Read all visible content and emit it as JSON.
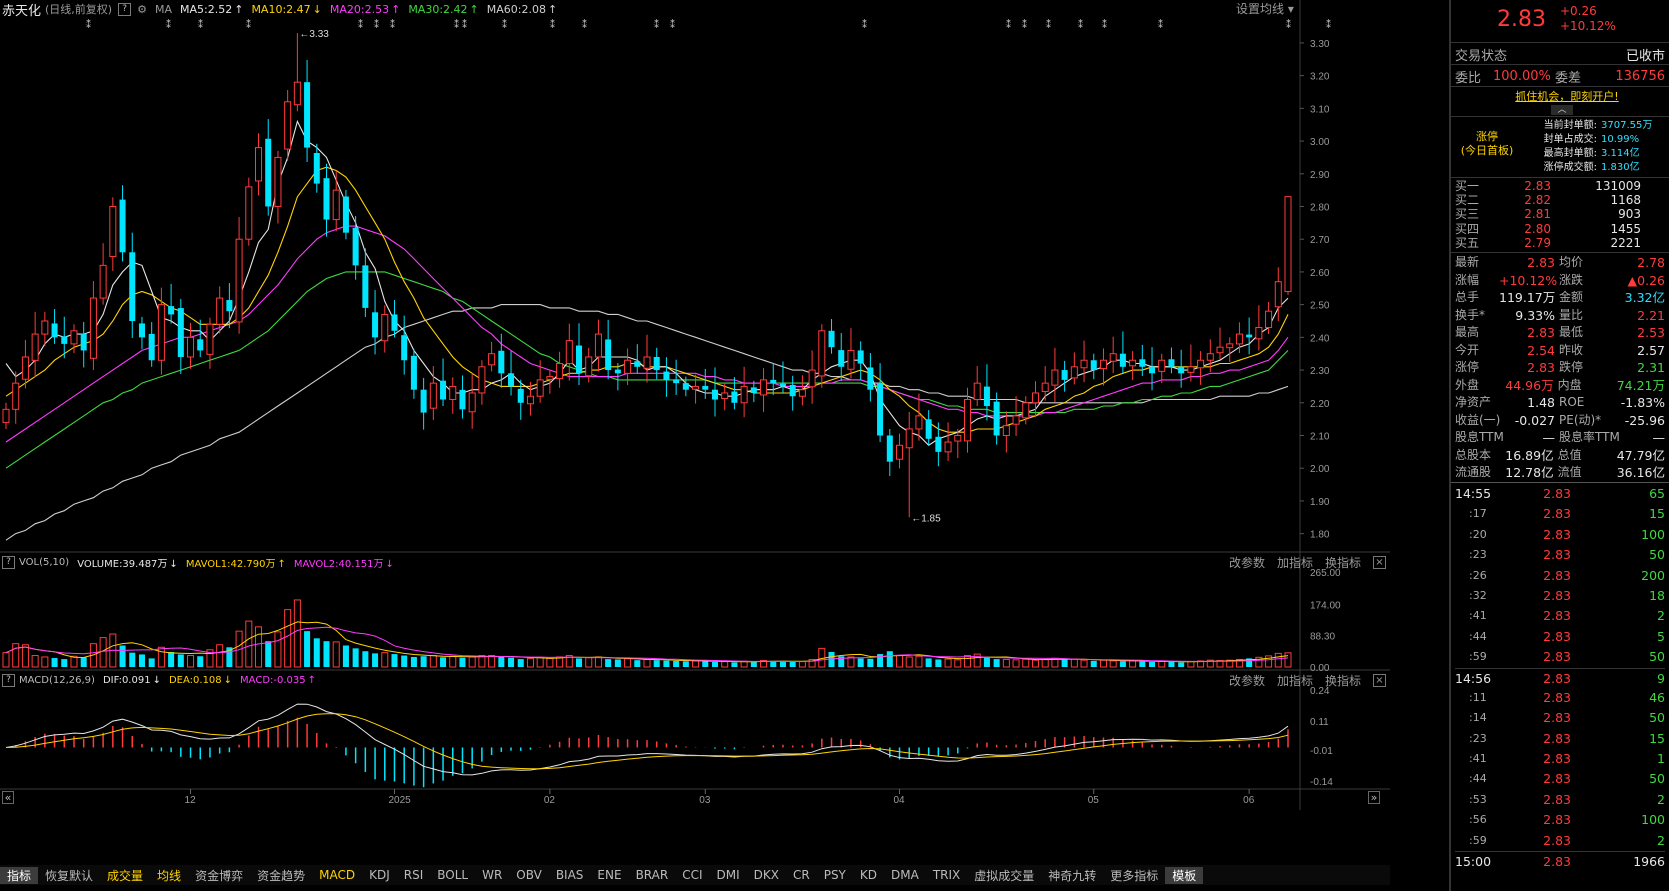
{
  "header": {
    "stock_name": "赤天化",
    "mode": "(日线,前复权)",
    "help": "?",
    "ma_label": "MA",
    "ma_items": [
      {
        "text": "MA5:2.52",
        "arrow": "↑",
        "color": "#e6e6e6"
      },
      {
        "text": "MA10:2.47",
        "arrow": "↓",
        "color": "#ffd400"
      },
      {
        "text": "MA20:2.53",
        "arrow": "↑",
        "color": "#ff3cff"
      },
      {
        "text": "MA30:2.42",
        "arrow": "↑",
        "color": "#3fd83f"
      },
      {
        "text": "MA60:2.08",
        "arrow": "↑",
        "color": "#cfcfcf"
      }
    ],
    "settings": "设置均线 ▾"
  },
  "price_axis": [
    "3.30",
    "3.20",
    "3.10",
    "3.00",
    "2.90",
    "2.80",
    "2.70",
    "2.60",
    "2.50",
    "2.40",
    "2.30",
    "2.20",
    "2.10",
    "2.00",
    "1.90",
    "1.80"
  ],
  "annotations": {
    "high": "3.33",
    "low": "1.85"
  },
  "vol_panel": {
    "help": "?",
    "name": "VOL(5,10)",
    "items": [
      {
        "text": "VOLUME:39.487万",
        "arrow": "↓",
        "color": "#e6e6e6"
      },
      {
        "text": "MAVOL1:42.790万",
        "arrow": "↑",
        "color": "#ffd400"
      },
      {
        "text": "MAVOL2:40.151万",
        "arrow": "↓",
        "color": "#ff3cff"
      }
    ],
    "tools": [
      "改参数",
      "加指标",
      "换指标"
    ],
    "close": "×",
    "axis": [
      "265.00",
      "174.00",
      "88.30",
      "0.00"
    ]
  },
  "macd_panel": {
    "help": "?",
    "name": "MACD(12,26,9)",
    "items": [
      {
        "text": "DIF:0.091",
        "arrow": "↓",
        "color": "#e6e6e6"
      },
      {
        "text": "DEA:0.108",
        "arrow": "↓",
        "color": "#ffd400"
      },
      {
        "text": "MACD:-0.035",
        "arrow": "↑",
        "color": "#ff3cff"
      }
    ],
    "tools": [
      "改参数",
      "加指标",
      "换指标"
    ],
    "close": "×",
    "axis": [
      "0.24",
      "0.11",
      "-0.01",
      "-0.14"
    ]
  },
  "date_axis": [
    "12",
    "2025",
    "02",
    "03",
    "04",
    "05",
    "06"
  ],
  "scroll": {
    "left": "«",
    "right": "»"
  },
  "bottom_tabs": [
    "指标",
    "恢复默认",
    "成交量",
    "均线",
    "资金博弈",
    "资金趋势",
    "MACD",
    "KDJ",
    "RSI",
    "BOLL",
    "WR",
    "OBV",
    "BIAS",
    "ENE",
    "BRAR",
    "CCI",
    "DMI",
    "DKX",
    "CR",
    "PSY",
    "KD",
    "DMA",
    "TRIX",
    "虚拟成交量",
    "神奇九转",
    "更多指标",
    "模板"
  ],
  "quote": {
    "price": "2.83",
    "change": "+0.26",
    "change_pct": "+10.12%",
    "status_label": "交易状态",
    "status_value": "已收市",
    "weibi_label": "委比",
    "weibi_value": "100.00%",
    "weicha_label": "委差",
    "weicha_value": "136756",
    "promo": "抓住机会，即刻开户!",
    "limit_title": "涨停",
    "limit_sub": "(今日首板)",
    "limit_info": [
      {
        "label": "当前封单额:",
        "value": "3707.55万"
      },
      {
        "label": "封单占成交:",
        "value": "10.99%"
      },
      {
        "label": "最高封单额:",
        "value": "3.114亿"
      },
      {
        "label": "涨停成交额:",
        "value": "1.830亿"
      }
    ],
    "bids": [
      {
        "label": "买一",
        "price": "2.83",
        "vol": "131009"
      },
      {
        "label": "买二",
        "price": "2.82",
        "vol": "1168"
      },
      {
        "label": "买三",
        "price": "2.81",
        "vol": "903"
      },
      {
        "label": "买四",
        "price": "2.80",
        "vol": "1455"
      },
      {
        "label": "买五",
        "price": "2.79",
        "vol": "2221"
      }
    ],
    "stats": [
      {
        "l1": "最新",
        "v1": "2.83",
        "c1": "red",
        "l2": "均价",
        "v2": "2.78",
        "c2": "red"
      },
      {
        "l1": "涨幅",
        "v1": "+10.12%",
        "c1": "red",
        "l2": "涨跌",
        "v2": "▲0.26",
        "c2": "red"
      },
      {
        "l1": "总手",
        "v1": "119.17万",
        "c1": "white",
        "l2": "金额",
        "v2": "3.32亿",
        "c2": "cyan"
      },
      {
        "l1": "换手*",
        "v1": "9.33%",
        "c1": "white",
        "l2": "量比",
        "v2": "2.21",
        "c2": "red"
      },
      {
        "l1": "最高",
        "v1": "2.83",
        "c1": "red",
        "l2": "最低",
        "v2": "2.53",
        "c2": "red"
      },
      {
        "l1": "今开",
        "v1": "2.54",
        "c1": "red",
        "l2": "昨收",
        "v2": "2.57",
        "c2": "white"
      },
      {
        "l1": "涨停",
        "v1": "2.83",
        "c1": "red",
        "l2": "跌停",
        "v2": "2.31",
        "c2": "green"
      },
      {
        "l1": "外盘",
        "v1": "44.96万",
        "c1": "red",
        "l2": "内盘",
        "v2": "74.21万",
        "c2": "green"
      },
      {
        "l1": "净资产",
        "v1": "1.48",
        "c1": "white",
        "l2": "ROE",
        "v2": "-1.83%",
        "c2": "white"
      },
      {
        "l1": "收益(一)",
        "v1": "-0.027",
        "c1": "white",
        "l2": "PE(动)*",
        "v2": "-25.96",
        "c2": "white"
      },
      {
        "l1": "股息TTM",
        "v1": "—",
        "c1": "white",
        "l2": "股息率TTM",
        "v2": "—",
        "c2": "white"
      },
      {
        "l1": "总股本",
        "v1": "16.89亿",
        "c1": "white",
        "l2": "总值",
        "v2": "47.79亿",
        "c2": "white"
      },
      {
        "l1": "流通股",
        "v1": "12.78亿",
        "c1": "white",
        "l2": "流值",
        "v2": "36.16亿",
        "c2": "white"
      }
    ],
    "ticks": [
      {
        "time": "14:55",
        "price": "2.83",
        "vol": "65"
      },
      {
        "time": ":17",
        "price": "2.83",
        "vol": "15"
      },
      {
        "time": ":20",
        "price": "2.83",
        "vol": "100"
      },
      {
        "time": ":23",
        "price": "2.83",
        "vol": "50"
      },
      {
        "time": ":26",
        "price": "2.83",
        "vol": "200"
      },
      {
        "time": ":32",
        "price": "2.83",
        "vol": "18"
      },
      {
        "time": ":41",
        "price": "2.83",
        "vol": "2"
      },
      {
        "time": ":44",
        "price": "2.83",
        "vol": "5"
      },
      {
        "time": ":59",
        "price": "2.83",
        "vol": "50"
      },
      {
        "time": "14:56",
        "price": "2.83",
        "vol": "9"
      },
      {
        "time": ":11",
        "price": "2.83",
        "vol": "46"
      },
      {
        "time": ":14",
        "price": "2.83",
        "vol": "50"
      },
      {
        "time": ":23",
        "price": "2.83",
        "vol": "15"
      },
      {
        "time": ":41",
        "price": "2.83",
        "vol": "1"
      },
      {
        "time": ":44",
        "price": "2.83",
        "vol": "50"
      },
      {
        "time": ":53",
        "price": "2.83",
        "vol": "2"
      },
      {
        "time": ":56",
        "price": "2.83",
        "vol": "100"
      },
      {
        "time": ":59",
        "price": "2.83",
        "vol": "2"
      },
      {
        "time": "15:00",
        "price": "2.83",
        "vol": "1966"
      }
    ]
  },
  "chart_data": {
    "type": "candlestick",
    "y_range": [
      1.75,
      3.37
    ],
    "closes": [
      2.18,
      2.26,
      2.34,
      2.41,
      2.45,
      2.4,
      2.38,
      2.42,
      2.36,
      2.52,
      2.62,
      2.8,
      2.66,
      2.45,
      2.4,
      2.33,
      2.5,
      2.47,
      2.34,
      2.4,
      2.36,
      2.44,
      2.52,
      2.48,
      2.7,
      2.86,
      2.98,
      2.8,
      2.95,
      3.12,
      3.18,
      2.98,
      2.87,
      2.76,
      2.85,
      2.72,
      2.62,
      2.49,
      2.4,
      2.47,
      2.42,
      2.33,
      2.24,
      2.17,
      2.26,
      2.21,
      2.25,
      2.18,
      2.23,
      2.31,
      2.35,
      2.29,
      2.25,
      2.2,
      2.22,
      2.27,
      2.28,
      2.32,
      2.39,
      2.29,
      2.34,
      2.41,
      2.3,
      2.29,
      2.33,
      2.31,
      2.34,
      2.3,
      2.27,
      2.26,
      2.24,
      2.25,
      2.24,
      2.21,
      2.23,
      2.2,
      2.25,
      2.23,
      2.27,
      2.26,
      2.25,
      2.22,
      2.24,
      2.3,
      2.42,
      2.37,
      2.31,
      2.36,
      2.32,
      2.24,
      2.1,
      2.02,
      2.07,
      2.12,
      2.16,
      2.09,
      2.05,
      2.08,
      2.1,
      2.21,
      2.26,
      2.19,
      2.1,
      2.13,
      2.16,
      2.2,
      2.23,
      2.26,
      2.3,
      2.27,
      2.31,
      2.33,
      2.3,
      2.33,
      2.35,
      2.31,
      2.33,
      2.31,
      2.29,
      2.33,
      2.31,
      2.29,
      2.31,
      2.33,
      2.35,
      2.37,
      2.38,
      2.41,
      2.4,
      2.43,
      2.48,
      2.57,
      2.83
    ],
    "volumes": [
      40,
      65,
      62,
      32,
      28,
      25,
      22,
      30,
      27,
      65,
      82,
      92,
      60,
      40,
      35,
      24,
      55,
      42,
      35,
      32,
      30,
      48,
      62,
      55,
      100,
      128,
      112,
      72,
      98,
      160,
      187,
      100,
      80,
      72,
      70,
      60,
      52,
      44,
      38,
      40,
      36,
      32,
      28,
      30,
      32,
      27,
      30,
      26,
      28,
      32,
      32,
      28,
      26,
      22,
      24,
      27,
      24,
      28,
      32,
      24,
      26,
      28,
      22,
      21,
      23,
      19,
      21,
      19,
      18,
      17,
      16,
      17,
      16,
      14,
      15,
      13,
      16,
      15,
      18,
      17,
      16,
      14,
      15,
      21,
      52,
      42,
      30,
      28,
      24,
      23,
      36,
      44,
      32,
      28,
      30,
      24,
      21,
      22,
      20,
      32,
      36,
      28,
      22,
      21,
      20,
      22,
      19,
      21,
      24,
      21,
      22,
      19,
      17,
      19,
      17,
      16,
      17,
      15,
      14,
      16,
      15,
      13,
      15,
      17,
      19,
      18,
      19,
      21,
      24,
      27,
      31,
      38,
      39.487
    ],
    "ma5": [
      2.32,
      2.28,
      2.3,
      2.33,
      2.38,
      2.41,
      2.4,
      2.41,
      2.41,
      2.42,
      2.47,
      2.56,
      2.6,
      2.63,
      2.62,
      2.54,
      2.46,
      2.45,
      2.43,
      2.42,
      2.42,
      2.39,
      2.42,
      2.45,
      2.52,
      2.6,
      2.69,
      2.73,
      2.87,
      2.95,
      3.06,
      3.0,
      2.98,
      2.95,
      2.88,
      2.81,
      2.75,
      2.66,
      2.61,
      2.51,
      2.45,
      2.42,
      2.36,
      2.32,
      2.28,
      2.26,
      2.23,
      2.23,
      2.24,
      2.24,
      2.26,
      2.27,
      2.29,
      2.26,
      2.24,
      2.25,
      2.26,
      2.29,
      2.33,
      2.3,
      2.31,
      2.34,
      2.34,
      2.34,
      2.34,
      2.33,
      2.3,
      2.31,
      2.31,
      2.29,
      2.26,
      2.24,
      2.23,
      2.23,
      2.22,
      2.22,
      2.23,
      2.24,
      2.24,
      2.24,
      2.25,
      2.24,
      2.24,
      2.27,
      2.29,
      2.31,
      2.32,
      2.33,
      2.33,
      2.29,
      2.21,
      2.17,
      2.13,
      2.11,
      2.1,
      2.07,
      2.09,
      2.1,
      2.11,
      2.13,
      2.15,
      2.16,
      2.15,
      2.16,
      2.16,
      2.17,
      2.18,
      2.22,
      2.24,
      2.26,
      2.28,
      2.29,
      2.3,
      2.31,
      2.33,
      2.33,
      2.32,
      2.32,
      2.31,
      2.31,
      2.31,
      2.3,
      2.3,
      2.31,
      2.32,
      2.33,
      2.35,
      2.37,
      2.38,
      2.41,
      2.43,
      2.49,
      2.52
    ],
    "ma10": [
      2.22,
      2.24,
      2.26,
      2.28,
      2.3,
      2.33,
      2.35,
      2.37,
      2.38,
      2.39,
      2.41,
      2.45,
      2.5,
      2.53,
      2.54,
      2.53,
      2.51,
      2.49,
      2.48,
      2.46,
      2.44,
      2.44,
      2.44,
      2.44,
      2.46,
      2.49,
      2.54,
      2.59,
      2.66,
      2.74,
      2.83,
      2.87,
      2.91,
      2.92,
      2.91,
      2.89,
      2.85,
      2.8,
      2.75,
      2.7,
      2.63,
      2.57,
      2.52,
      2.46,
      2.42,
      2.38,
      2.34,
      2.31,
      2.29,
      2.27,
      2.26,
      2.25,
      2.25,
      2.25,
      2.25,
      2.26,
      2.27,
      2.28,
      2.29,
      2.29,
      2.3,
      2.3,
      2.31,
      2.31,
      2.32,
      2.32,
      2.31,
      2.31,
      2.31,
      2.3,
      2.29,
      2.28,
      2.27,
      2.26,
      2.25,
      2.24,
      2.24,
      2.23,
      2.23,
      2.23,
      2.23,
      2.23,
      2.24,
      2.25,
      2.26,
      2.27,
      2.28,
      2.29,
      2.3,
      2.29,
      2.27,
      2.24,
      2.22,
      2.19,
      2.17,
      2.14,
      2.12,
      2.11,
      2.11,
      2.11,
      2.12,
      2.12,
      2.12,
      2.13,
      2.14,
      2.15,
      2.16,
      2.18,
      2.19,
      2.2,
      2.22,
      2.23,
      2.25,
      2.26,
      2.28,
      2.29,
      2.3,
      2.3,
      2.31,
      2.31,
      2.31,
      2.31,
      2.31,
      2.31,
      2.31,
      2.32,
      2.32,
      2.33,
      2.34,
      2.35,
      2.37,
      2.41,
      2.47
    ],
    "ma20": [
      2.08,
      2.1,
      2.12,
      2.14,
      2.16,
      2.18,
      2.2,
      2.22,
      2.24,
      2.26,
      2.28,
      2.3,
      2.32,
      2.34,
      2.36,
      2.37,
      2.38,
      2.39,
      2.4,
      2.4,
      2.41,
      2.42,
      2.43,
      2.44,
      2.45,
      2.47,
      2.5,
      2.53,
      2.56,
      2.6,
      2.64,
      2.67,
      2.7,
      2.72,
      2.73,
      2.74,
      2.74,
      2.73,
      2.72,
      2.71,
      2.69,
      2.67,
      2.64,
      2.61,
      2.58,
      2.55,
      2.52,
      2.49,
      2.46,
      2.43,
      2.41,
      2.38,
      2.36,
      2.34,
      2.32,
      2.31,
      2.3,
      2.29,
      2.28,
      2.28,
      2.28,
      2.28,
      2.28,
      2.28,
      2.29,
      2.29,
      2.29,
      2.29,
      2.29,
      2.29,
      2.29,
      2.29,
      2.28,
      2.28,
      2.27,
      2.27,
      2.26,
      2.26,
      2.26,
      2.26,
      2.25,
      2.25,
      2.25,
      2.25,
      2.26,
      2.26,
      2.27,
      2.27,
      2.27,
      2.26,
      2.25,
      2.24,
      2.23,
      2.22,
      2.21,
      2.2,
      2.19,
      2.18,
      2.18,
      2.17,
      2.17,
      2.16,
      2.16,
      2.16,
      2.16,
      2.16,
      2.16,
      2.17,
      2.17,
      2.18,
      2.19,
      2.2,
      2.21,
      2.22,
      2.23,
      2.24,
      2.25,
      2.26,
      2.26,
      2.27,
      2.27,
      2.27,
      2.28,
      2.28,
      2.29,
      2.29,
      2.3,
      2.3,
      2.31,
      2.32,
      2.33,
      2.36,
      2.4
    ],
    "ma30": [
      2.0,
      2.02,
      2.04,
      2.06,
      2.08,
      2.1,
      2.12,
      2.14,
      2.16,
      2.18,
      2.2,
      2.21,
      2.23,
      2.24,
      2.26,
      2.27,
      2.28,
      2.29,
      2.3,
      2.31,
      2.32,
      2.33,
      2.34,
      2.35,
      2.36,
      2.38,
      2.4,
      2.42,
      2.45,
      2.48,
      2.51,
      2.54,
      2.56,
      2.58,
      2.59,
      2.6,
      2.6,
      2.6,
      2.6,
      2.6,
      2.59,
      2.58,
      2.57,
      2.56,
      2.55,
      2.54,
      2.52,
      2.51,
      2.49,
      2.47,
      2.45,
      2.43,
      2.41,
      2.39,
      2.37,
      2.35,
      2.34,
      2.32,
      2.31,
      2.3,
      2.29,
      2.28,
      2.28,
      2.27,
      2.27,
      2.27,
      2.27,
      2.27,
      2.27,
      2.27,
      2.27,
      2.27,
      2.27,
      2.26,
      2.26,
      2.26,
      2.26,
      2.26,
      2.26,
      2.26,
      2.26,
      2.26,
      2.26,
      2.26,
      2.26,
      2.26,
      2.26,
      2.26,
      2.26,
      2.25,
      2.25,
      2.24,
      2.23,
      2.22,
      2.21,
      2.21,
      2.2,
      2.19,
      2.19,
      2.18,
      2.18,
      2.18,
      2.17,
      2.17,
      2.17,
      2.17,
      2.17,
      2.17,
      2.17,
      2.17,
      2.18,
      2.18,
      2.18,
      2.19,
      2.19,
      2.2,
      2.2,
      2.21,
      2.21,
      2.22,
      2.22,
      2.23,
      2.23,
      2.24,
      2.25,
      2.25,
      2.26,
      2.27,
      2.28,
      2.29,
      2.3,
      2.33,
      2.36
    ],
    "ma60": [
      1.78,
      1.8,
      1.81,
      1.83,
      1.84,
      1.86,
      1.87,
      1.89,
      1.9,
      1.91,
      1.93,
      1.94,
      1.96,
      1.97,
      1.98,
      2.0,
      2.01,
      2.02,
      2.04,
      2.05,
      2.06,
      2.07,
      2.09,
      2.1,
      2.11,
      2.13,
      2.15,
      2.17,
      2.19,
      2.21,
      2.23,
      2.25,
      2.27,
      2.29,
      2.31,
      2.33,
      2.35,
      2.37,
      2.38,
      2.4,
      2.41,
      2.43,
      2.44,
      2.45,
      2.46,
      2.47,
      2.48,
      2.48,
      2.49,
      2.49,
      2.49,
      2.5,
      2.5,
      2.5,
      2.5,
      2.5,
      2.49,
      2.49,
      2.49,
      2.48,
      2.48,
      2.48,
      2.47,
      2.47,
      2.46,
      2.45,
      2.45,
      2.44,
      2.43,
      2.42,
      2.41,
      2.4,
      2.39,
      2.38,
      2.37,
      2.36,
      2.35,
      2.34,
      2.33,
      2.32,
      2.31,
      2.3,
      2.3,
      2.29,
      2.29,
      2.28,
      2.28,
      2.27,
      2.27,
      2.26,
      2.26,
      2.25,
      2.25,
      2.24,
      2.24,
      2.23,
      2.23,
      2.22,
      2.22,
      2.22,
      2.21,
      2.21,
      2.21,
      2.21,
      2.21,
      2.2,
      2.2,
      2.2,
      2.2,
      2.2,
      2.2,
      2.2,
      2.2,
      2.2,
      2.2,
      2.2,
      2.2,
      2.2,
      2.21,
      2.21,
      2.21,
      2.21,
      2.21,
      2.21,
      2.21,
      2.22,
      2.22,
      2.22,
      2.22,
      2.23,
      2.23,
      2.24,
      2.25
    ]
  },
  "colors": {
    "up": "#ff3b3b",
    "down": "#00e5ff",
    "ma5": "#e6e6e6",
    "ma10": "#ffd400",
    "ma20": "#ff3cff",
    "ma30": "#3fd83f",
    "ma60": "#cfcfcf"
  }
}
